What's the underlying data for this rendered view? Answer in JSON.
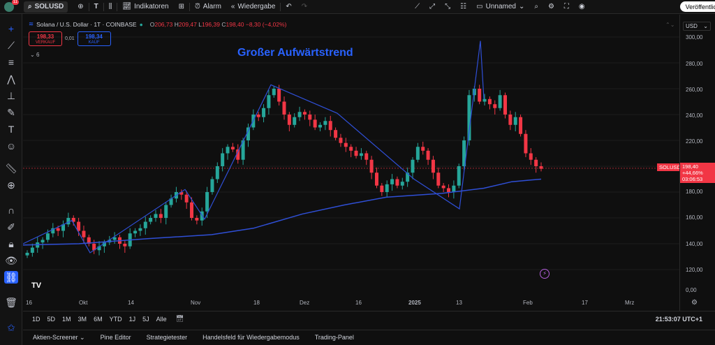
{
  "topbar": {
    "avatar_badge": "11",
    "symbol": "SOLUSD",
    "timeframe": "T",
    "indicators": "Indikatoren",
    "alarm": "Alarm",
    "replay": "Wiedergabe",
    "layout_name": "Unnamed",
    "publish": "Veröffentlic"
  },
  "legend": {
    "title": "Solana / U.S. Dollar · 1T · COINBASE",
    "o_key": "O",
    "o_val": "206,73",
    "h_key": "H",
    "h_val": "209,47",
    "l_key": "L",
    "l_val": "196,39",
    "c_key": "C",
    "c_val": "198,40",
    "change": "−8,30 (−4,02%)"
  },
  "trade": {
    "sell_price": "198,33",
    "sell_label": "VERKAUF",
    "spread": "0,01",
    "buy_price": "198,34",
    "buy_label": "KAUF",
    "collapsed_count": "6"
  },
  "annotation": "Großer Aufwärtstrend",
  "price_axis": {
    "currency": "USD",
    "labels": [
      "300,00",
      "280,00",
      "260,00",
      "240,00",
      "220,00",
      "200,00",
      "180,00",
      "160,00",
      "140,00",
      "120,00",
      "0,00"
    ],
    "current_price": "198,40",
    "current_change": "+44,66%",
    "countdown": "03:06:53",
    "symbol_tag": "SOLUSD"
  },
  "time_axis": [
    "16",
    "Okt",
    "14",
    "Nov",
    "18",
    "Dez",
    "16",
    "2025",
    "13",
    "Feb",
    "17",
    "Mrz"
  ],
  "ranges": [
    "1D",
    "5D",
    "1M",
    "3M",
    "6M",
    "YTD",
    "1J",
    "5J",
    "Alle"
  ],
  "clock": "21:53:07 UTC+1",
  "bottom_tabs": [
    "Aktien-Screener",
    "Pine Editor",
    "Strategietester",
    "Handelsfeld für Wiedergabemodus",
    "Trading-Panel"
  ],
  "colors": {
    "bull": "#26a69a",
    "bear": "#f23645",
    "accent": "#2962ff",
    "ma": "#2f4fd6"
  },
  "chart_data": {
    "type": "candlestick",
    "ylim": [
      110,
      305
    ],
    "ma_series_name": "",
    "candles_close_approx": [
      133,
      137,
      141,
      143,
      148,
      152,
      150,
      155,
      160,
      157,
      150,
      145,
      140,
      135,
      138,
      141,
      143,
      145,
      140,
      138,
      148,
      150,
      152,
      157,
      160,
      163,
      160,
      170,
      175,
      180,
      178,
      172,
      160,
      158,
      165,
      180,
      190,
      200,
      210,
      215,
      213,
      205,
      220,
      230,
      240,
      238,
      245,
      255,
      260,
      250,
      240,
      232,
      238,
      242,
      240,
      236,
      230,
      232,
      235,
      228,
      222,
      218,
      215,
      212,
      208,
      210,
      205,
      195,
      185,
      180,
      186,
      190,
      185,
      188,
      195,
      205,
      215,
      212,
      205,
      195,
      185,
      183,
      180,
      185,
      200,
      220,
      255,
      260,
      250,
      252,
      248,
      245,
      255,
      240,
      232,
      238,
      225,
      210,
      205,
      200,
      198
    ]
  }
}
